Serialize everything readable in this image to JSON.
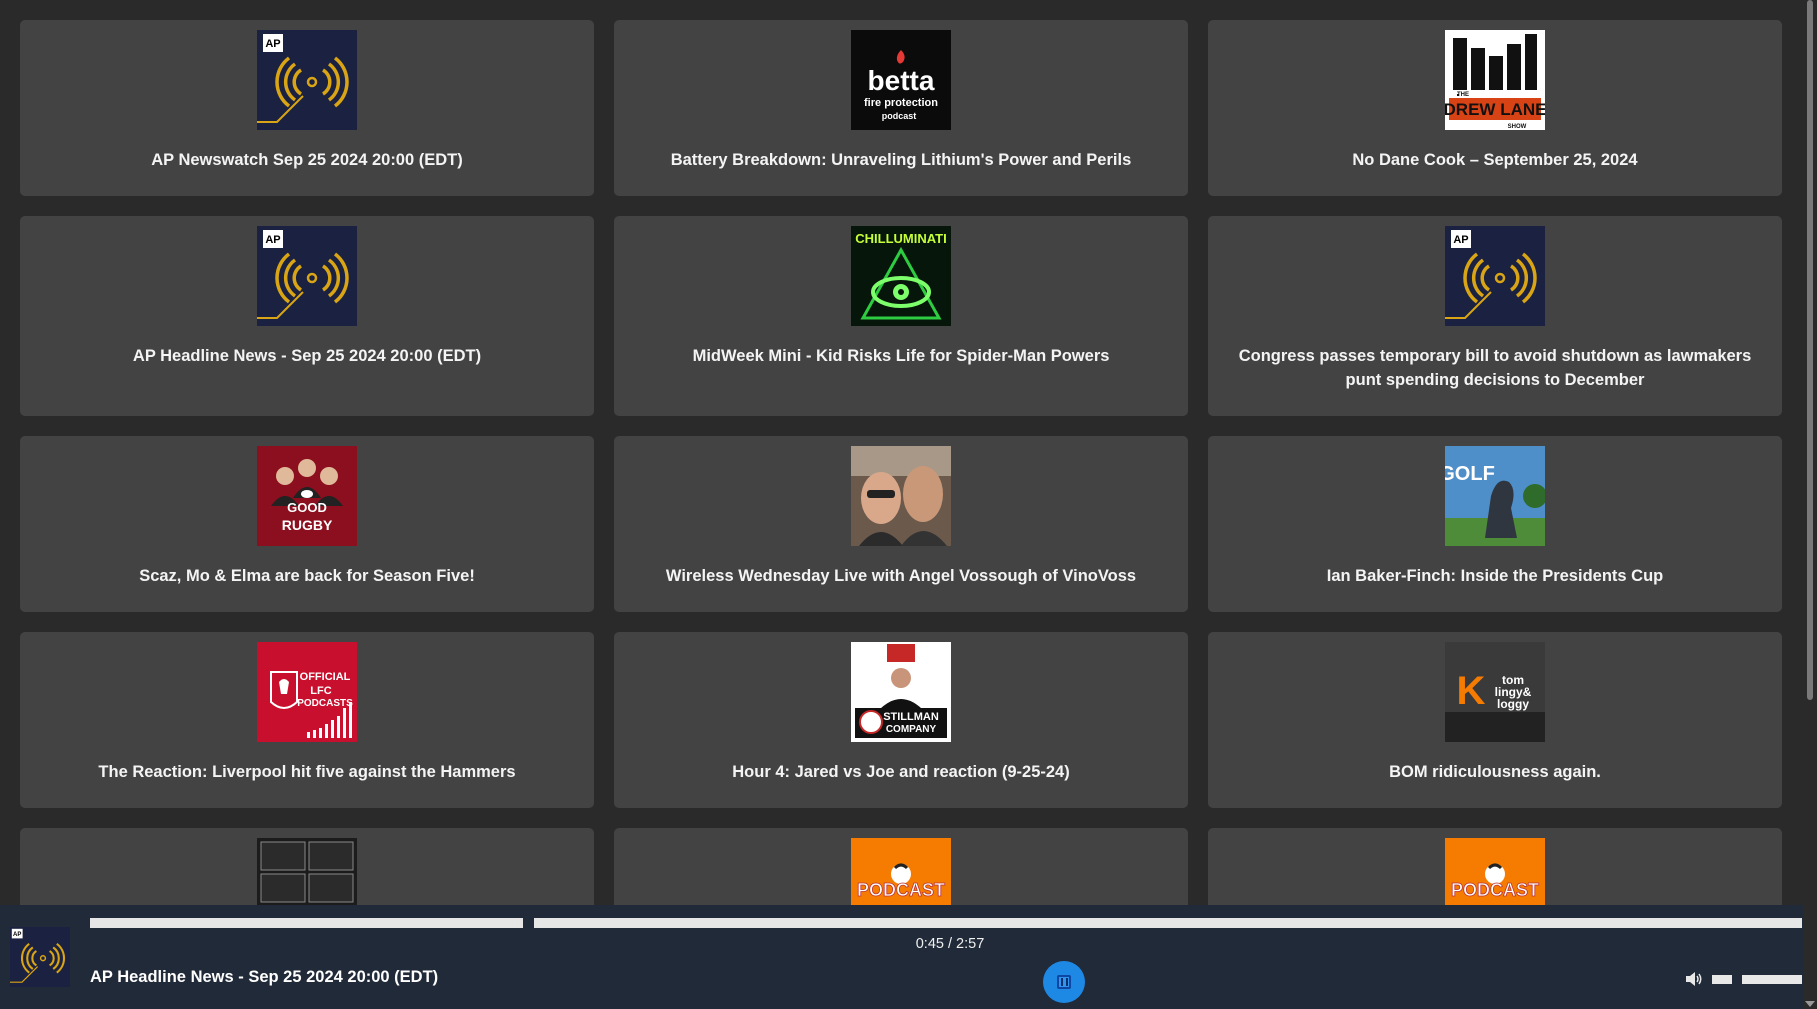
{
  "cards": [
    {
      "title": "AP Newswatch Sep 25 2024 20:00 (EDT)",
      "art": "ap-icon"
    },
    {
      "title": "Battery Breakdown: Unraveling Lithium's Power and Perils",
      "art": "betta-icon",
      "art_text": {
        "line1": "betta",
        "line2": "fire protection",
        "line3": "podcast"
      }
    },
    {
      "title": "No Dane Cook – September 25, 2024",
      "art": "drew-lane-icon",
      "art_text": {
        "line1": "DREW LANE",
        "line2": "THE",
        "line3": "SHOW"
      }
    },
    {
      "title": "AP Headline News - Sep 25 2024 20:00 (EDT)",
      "art": "ap-icon"
    },
    {
      "title": "MidWeek Mini - Kid Risks Life for Spider-Man Powers",
      "art": "chilluminati-icon",
      "art_text": {
        "line1": "CHILLUMINATI"
      }
    },
    {
      "title": "Congress passes temporary bill to avoid shutdown as lawmakers punt spending decisions to December",
      "art": "ap-icon"
    },
    {
      "title": "Scaz, Mo & Elma are back for Season Five!",
      "art": "good-rugby-icon",
      "art_text": {
        "line1": "GOOD",
        "line2": "RUGBY"
      }
    },
    {
      "title": "Wireless Wednesday Live with Angel Vossough of VinoVoss",
      "art": "photo-icon"
    },
    {
      "title": "Ian Baker-Finch: Inside the Presidents Cup",
      "art": "golf-icon",
      "art_text": {
        "line1": "GOLF"
      }
    },
    {
      "title": "The Reaction: Liverpool hit five against the Hammers",
      "art": "lfc-icon",
      "art_text": {
        "line1": "OFFICIAL",
        "line2": "LFC",
        "line3": "PODCASTS"
      }
    },
    {
      "title": "Hour 4: Jared vs Joe and reaction (9-25-24)",
      "art": "stillman-icon",
      "art_text": {
        "line1": "STILLMAN",
        "line2": "COMPANY"
      }
    },
    {
      "title": "BOM ridiculousness again.",
      "art": "k-radio-icon",
      "art_text": {
        "line1": "K",
        "line2": "tom",
        "line3": "lingy&",
        "line4": "loggy"
      }
    },
    {
      "title": "",
      "art": "amp-icon"
    },
    {
      "title": "",
      "art": "podcast-orange-icon",
      "art_text": {
        "line1": "PODCAST"
      }
    },
    {
      "title": "",
      "art": "podcast-orange-icon",
      "art_text": {
        "line1": "PODCAST"
      }
    }
  ],
  "ap_label": "AP",
  "player": {
    "title": "AP Headline News - Sep 25 2024 20:00 (EDT)",
    "time": "0:45 / 2:57",
    "progress": 0.254,
    "state": "playing",
    "play_icon": "pause-icon",
    "volume_icon": "speaker-icon"
  },
  "colors": {
    "background": "#2a2a2a",
    "card": "#434343",
    "player": "#212a38",
    "accent": "#1e88e5"
  }
}
